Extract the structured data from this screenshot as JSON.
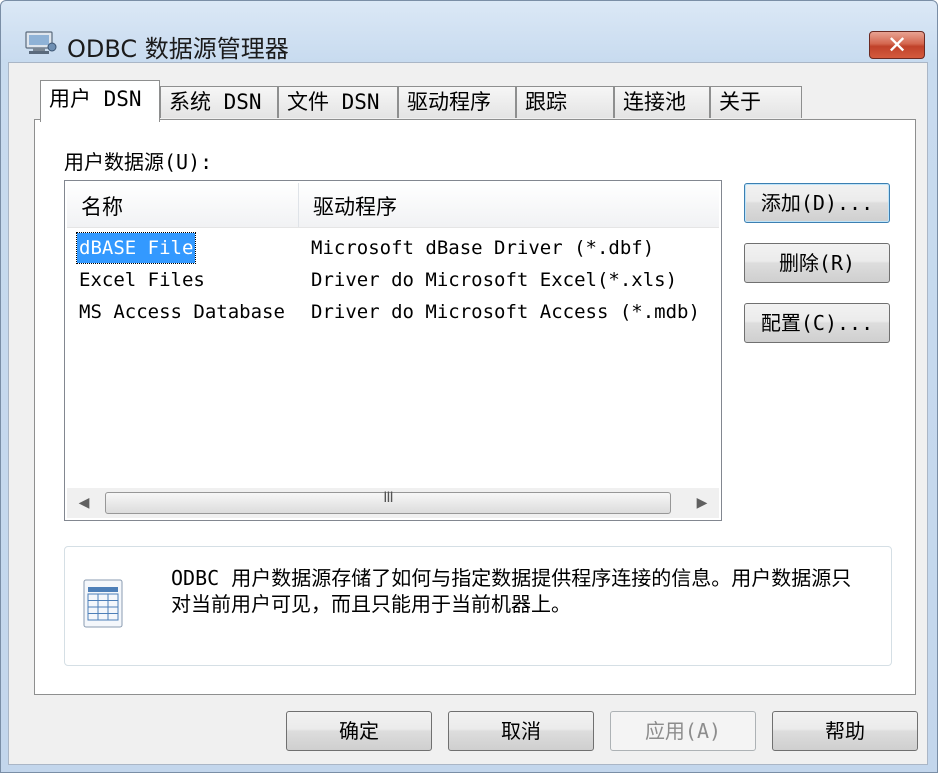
{
  "window": {
    "title": "ODBC 数据源管理器",
    "close_label": "✕"
  },
  "tabs": [
    {
      "label": "用户 DSN",
      "active": true
    },
    {
      "label": "系统 DSN",
      "active": false
    },
    {
      "label": "文件 DSN",
      "active": false
    },
    {
      "label": "驱动程序",
      "active": false
    },
    {
      "label": "跟踪",
      "active": false
    },
    {
      "label": "连接池",
      "active": false
    },
    {
      "label": "关于",
      "active": false
    }
  ],
  "user_dsn": {
    "section_label": "用户数据源(U):",
    "columns": [
      "名称",
      "驱动程序"
    ],
    "rows": [
      {
        "name": "dBASE File",
        "driver": "Microsoft dBase Driver (*.dbf)",
        "selected": true
      },
      {
        "name": "Excel Files",
        "driver": "Driver do Microsoft Excel(*.xls)",
        "selected": false
      },
      {
        "name": "MS Access Database",
        "driver": "Driver do Microsoft Access (*.mdb)",
        "selected": false
      }
    ],
    "scrollbar": {
      "left_arrow": "◀",
      "right_arrow": "▶",
      "grip": "III"
    },
    "buttons": {
      "add": "添加(D)...",
      "remove": "删除(R)",
      "configure": "配置(C)..."
    },
    "info_text": "ODBC 用户数据源存储了如何与指定数据提供程序连接的信息。用户数据源只对当前用户可见，而且只能用于当前机器上。"
  },
  "footer_buttons": {
    "ok": "确定",
    "cancel": "取消",
    "apply": "应用(A)",
    "help": "帮助"
  },
  "colors": {
    "selection": "#3399ff",
    "close_button": "#c9503a",
    "title_bar": "#c8dbef"
  }
}
